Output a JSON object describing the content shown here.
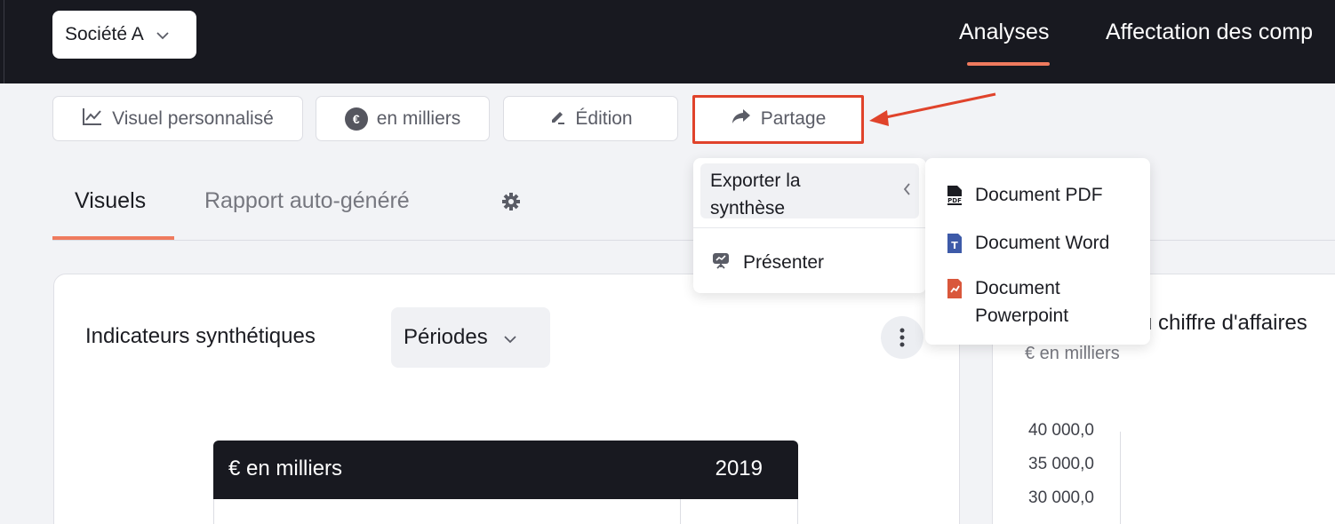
{
  "header": {
    "company_selector": "Société A",
    "nav": [
      "Analyses",
      "Affectation des comp"
    ]
  },
  "toolbar": {
    "custom_visual": "Visuel personnalisé",
    "units": "en milliers",
    "edit": "Édition",
    "share": "Partage"
  },
  "tabs": {
    "visuals": "Visuels",
    "auto_report": "Rapport auto-généré"
  },
  "share_menu": {
    "export_label": "Exporter la synthèse",
    "present_label": "Présenter",
    "export_submenu": [
      "Document PDF",
      "Document Word",
      "Document Powerpoint"
    ]
  },
  "indicators_card": {
    "title": "Indicateurs synthétiques",
    "period_selector": "Périodes",
    "table": {
      "header_unit": "€ en milliers",
      "header_year": "2019"
    }
  },
  "revenue_card": {
    "title": "u chiffre d'affaires",
    "subtitle": "€ en milliers",
    "y_ticks": [
      "40 000,0",
      "35 000,0",
      "30 000,0"
    ]
  },
  "colors": {
    "topbar": "#181920",
    "accent": "#ef7a5e",
    "annotation": "#e0432b"
  }
}
